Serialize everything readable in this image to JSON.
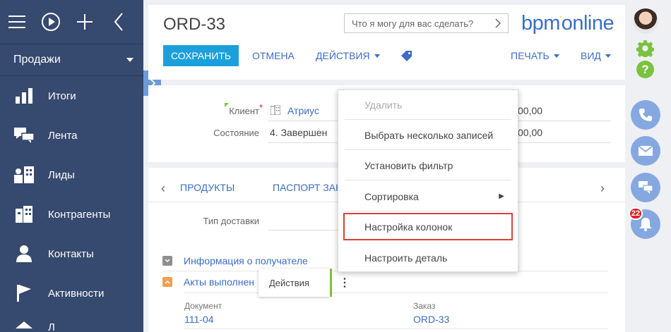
{
  "sidebar": {
    "workspace": "Продажи",
    "items": [
      {
        "label": "Итоги",
        "icon": "bar-chart-icon"
      },
      {
        "label": "Лента",
        "icon": "chat-icon"
      },
      {
        "label": "Лиды",
        "icon": "leads-icon"
      },
      {
        "label": "Контрагенты",
        "icon": "building-icon"
      },
      {
        "label": "Контакты",
        "icon": "person-icon"
      },
      {
        "label": "Активности",
        "icon": "flag-icon"
      },
      {
        "label": "Л",
        "icon": "doc-icon"
      }
    ]
  },
  "header": {
    "title": "ORD-33",
    "search_placeholder": "Что я могу для вас сделать?",
    "logo_main": "bpm",
    "logo_sup": "'",
    "logo_rest": "online",
    "save_label": "СОХРАНИТЬ",
    "cancel_label": "ОТМЕНА",
    "actions_label": "ДЕЙСТВИЯ",
    "print_label": "ПЕЧАТЬ",
    "view_label": "ВИД"
  },
  "rail": {
    "notification_count": "22"
  },
  "info": {
    "client_label": "Клиент",
    "client_required": "*",
    "client_value": "Атриус",
    "state_label": "Состояние",
    "state_value": "4. Завершен",
    "amount1": "00,00",
    "amount2": "00,00"
  },
  "detail": {
    "tabs": [
      "ПРОДУКТЫ",
      "ПАСПОРТ ЗАКА"
    ],
    "delivery_label": "Тип доставки",
    "group1": "Информация о получателе",
    "group2": "Акты выполнен",
    "tooltip": "Действия",
    "col_document": "Документ",
    "col_order": "Заказ",
    "doc_value": "111-04",
    "order_value": "ORD-33"
  },
  "menu": {
    "items": [
      {
        "label": "Удалить"
      },
      {
        "label": "Выбрать несколько записей"
      },
      {
        "label": "Установить фильтр"
      },
      {
        "label": "Сортировка"
      },
      {
        "label": "Настройка колонок"
      },
      {
        "label": "Настроить деталь"
      }
    ]
  },
  "colors": {
    "sidebar": "#36496e",
    "accent": "#1ba0dc",
    "link": "#3b6ec4",
    "green": "#7cc142",
    "highlight": "#d9403a"
  }
}
